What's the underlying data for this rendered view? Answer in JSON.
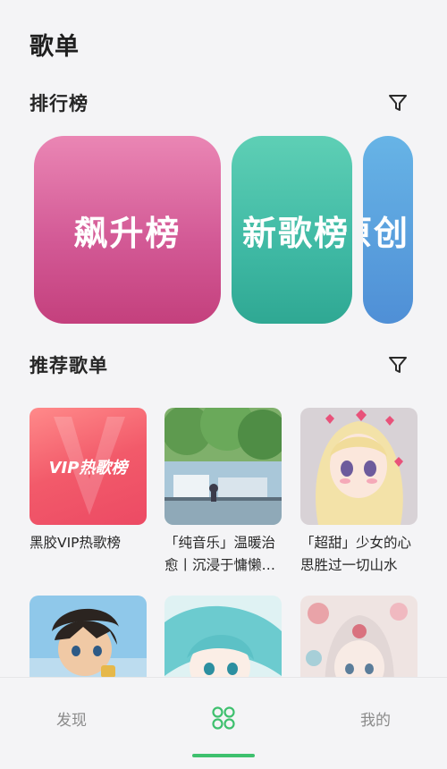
{
  "page": {
    "title": "歌单"
  },
  "ranking": {
    "title": "排行榜",
    "filter_icon": "filter-icon",
    "cards": [
      {
        "label": "飙升榜",
        "color": "#d35a96"
      },
      {
        "label": "新歌榜",
        "color": "#3fb9a4"
      },
      {
        "label": "原创",
        "color": "#4f8fd6"
      }
    ]
  },
  "recommended": {
    "title": "推荐歌单",
    "filter_icon": "filter-icon",
    "items": [
      {
        "name": "黑胶VIP热歌榜",
        "cover_text": "VIP热歌榜"
      },
      {
        "name": "「纯音乐」温暖治愈丨沉浸于慵懒的时光"
      },
      {
        "name": "「超甜」少女的心思胜过一切山水"
      },
      {
        "name": ""
      },
      {
        "name": ""
      },
      {
        "name": ""
      }
    ]
  },
  "tabbar": {
    "tabs": [
      {
        "label": "发现"
      },
      {
        "icon": "grid-icon",
        "active": true
      },
      {
        "label": "我的"
      }
    ],
    "accent": "#3ec06e"
  }
}
